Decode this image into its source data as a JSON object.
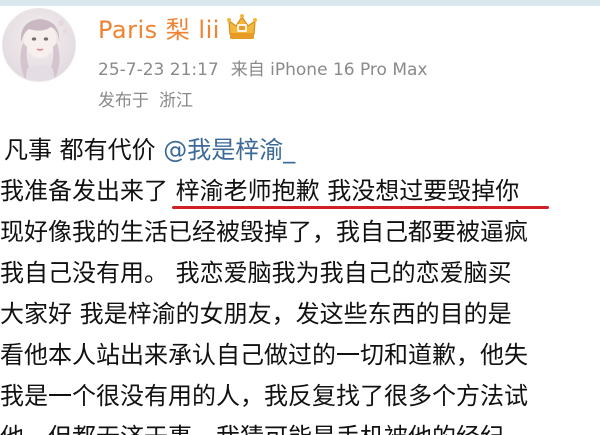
{
  "header": {
    "username": "Paris 梨 lii",
    "date": "25-7-23 21:17",
    "device": "来自 iPhone 16 Pro Max",
    "published_label": "发布于",
    "location": "浙江"
  },
  "post": {
    "first_line_text": "凡事 都有代价 ",
    "mention": "@我是梓渝_",
    "line2_before": "我准备发出来了 ",
    "line2_underlined": "梓渝老师抱歉 我没想过要毁掉你",
    "lines": [
      "现好像我的生活已经被毁掉了，我自己都要被逼疯",
      "我自己没有用。 我恋爱脑我为我自己的恋爱脑买",
      "大家好 我是梓渝的女朋友，发这些东西的目的是",
      "看他本人站出来承认自己做过的一切和道歉，他失",
      "我是一个很没有用的人，我反复找了很多个方法试"
    ],
    "last_line_partial": "他，但都无济于事，我猜可能是手机被他的经纪",
    "underline_color": "#d21f26",
    "mention_color": "#3c6a98",
    "username_color": "#f08232"
  }
}
